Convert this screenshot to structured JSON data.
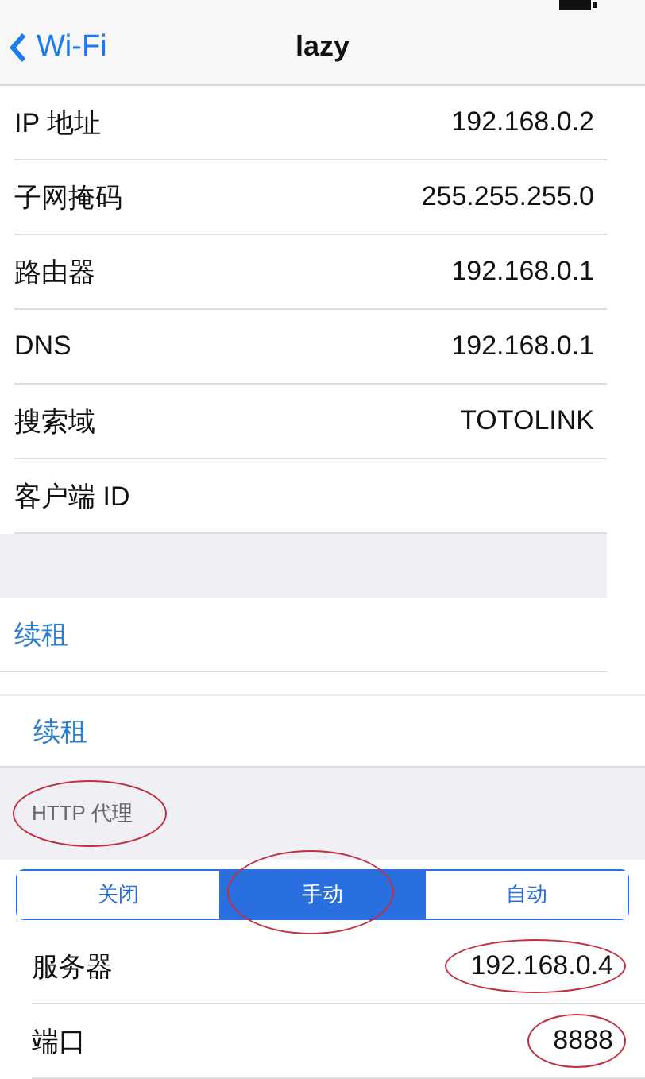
{
  "nav": {
    "back": "Wi-Fi",
    "title": "lazy"
  },
  "info_rows": [
    {
      "label": "IP 地址",
      "value": "192.168.0.2"
    },
    {
      "label": "子网掩码",
      "value": "255.255.255.0"
    },
    {
      "label": "路由器",
      "value": "192.168.0.1"
    },
    {
      "label": "DNS",
      "value": "192.168.0.1"
    },
    {
      "label": "搜索域",
      "value": "TOTOLINK"
    },
    {
      "label": "客户端 ID"
    }
  ],
  "renew_buttons": [
    "续租",
    "续租"
  ],
  "proxy": {
    "header": "HTTP 代理",
    "header_circled": true,
    "segments": [
      {
        "label": "关闭",
        "selected": false,
        "circled": false
      },
      {
        "label": "手动",
        "selected": true,
        "circled": true
      },
      {
        "label": "自动",
        "selected": false,
        "circled": false
      }
    ],
    "rows": [
      {
        "label": "服务器",
        "value": "192.168.0.4",
        "circled": true
      },
      {
        "label": "端口",
        "value": "8888",
        "circled": true
      }
    ]
  }
}
